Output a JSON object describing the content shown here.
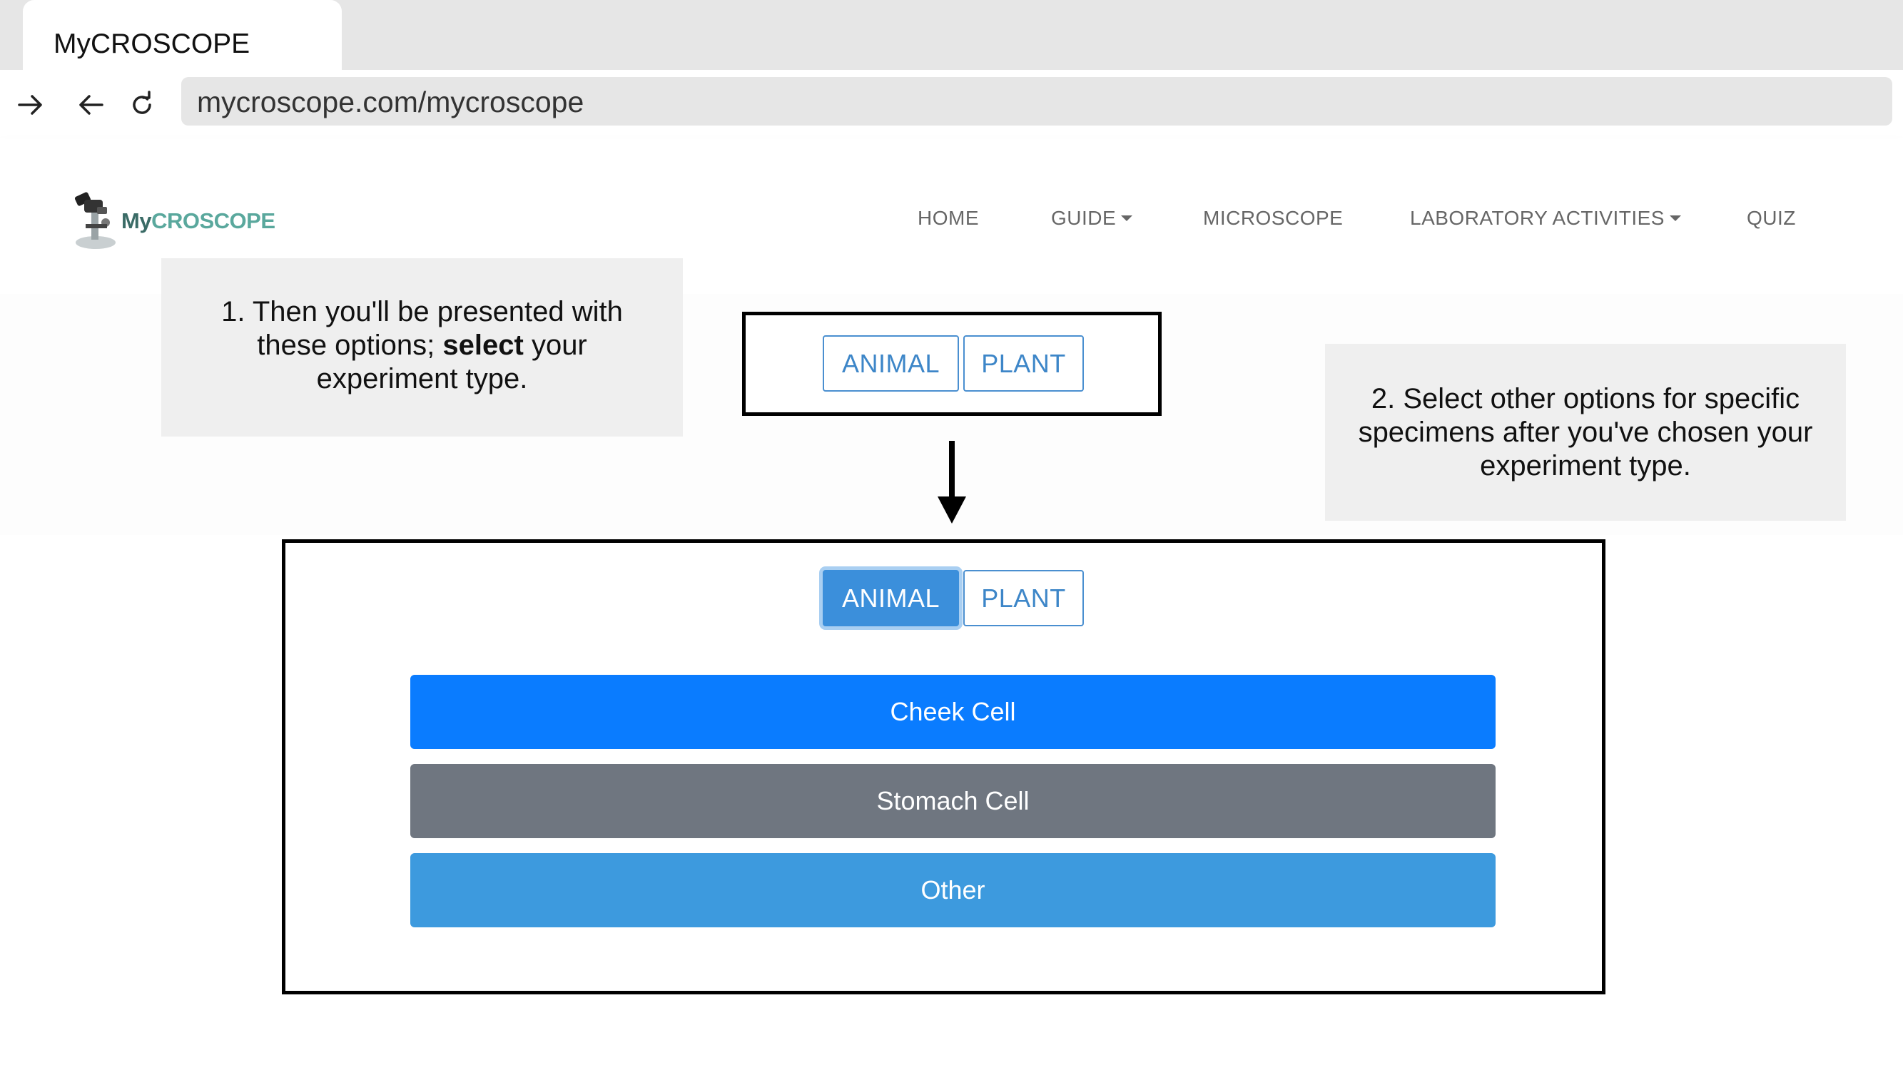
{
  "browser": {
    "tab_title": "MyCROSCOPE",
    "url": "mycroscope.com/mycroscope"
  },
  "site": {
    "logo_prefix": "My",
    "logo_suffix": "CROSCOPE",
    "nav": {
      "home": "HOME",
      "guide": "GUIDE",
      "microscope": "MICROSCOPE",
      "lab": "LABORATORY ACTIVITIES",
      "quiz": "QUIZ"
    }
  },
  "callouts": {
    "one_a": "1. Then you'll be presented with these options; ",
    "one_bold": "select",
    "one_b": " your experiment type.",
    "two": "2. Select other options for specific specimens after you've chosen your experiment type."
  },
  "step1": {
    "animal": "ANIMAL",
    "plant": "PLANT"
  },
  "step2": {
    "animal": "ANIMAL",
    "plant": "PLANT",
    "selected": "ANIMAL",
    "specimens": [
      "Cheek Cell",
      "Stomach Cell",
      "Other"
    ]
  },
  "colors": {
    "primary": "#0a7cff",
    "secondary": "#6f7680",
    "info": "#3d9ade",
    "toggle_outline": "#4a8fd0",
    "logo": "#3a6b66"
  }
}
